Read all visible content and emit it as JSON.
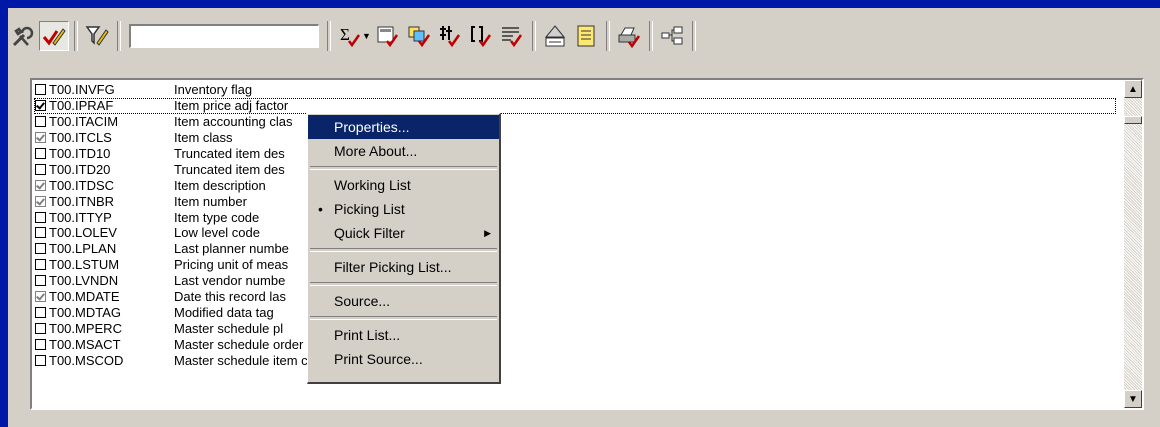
{
  "toolbar": {
    "buttons": [
      "tools-icon",
      "check-pencil-icon",
      "filter-icon"
    ],
    "search_value": ""
  },
  "list": {
    "rows": [
      {
        "name": "T00.INVFG",
        "desc": "Inventory flag",
        "state": "unchecked"
      },
      {
        "name": "T00.IPRAF",
        "desc": "Item price adj factor",
        "state": "checked"
      },
      {
        "name": "T00.ITACIM",
        "desc": "Item accounting clas",
        "state": "unchecked"
      },
      {
        "name": "T00.ITCLS",
        "desc": "Item class",
        "state": "grey"
      },
      {
        "name": "T00.ITD10",
        "desc": "Truncated item des",
        "state": "unchecked"
      },
      {
        "name": "T00.ITD20",
        "desc": "Truncated item des",
        "state": "unchecked"
      },
      {
        "name": "T00.ITDSC",
        "desc": "Item description",
        "state": "grey"
      },
      {
        "name": "T00.ITNBR",
        "desc": "Item number",
        "state": "grey"
      },
      {
        "name": "T00.ITTYP",
        "desc": "Item type code",
        "state": "unchecked"
      },
      {
        "name": "T00.LOLEV",
        "desc": "Low level code",
        "state": "unchecked"
      },
      {
        "name": "T00.LPLAN",
        "desc": "Last planner numbe",
        "state": "unchecked"
      },
      {
        "name": "T00.LSTUM",
        "desc": "Pricing unit of meas",
        "state": "unchecked"
      },
      {
        "name": "T00.LVNDN",
        "desc": "Last vendor numbe",
        "state": "unchecked"
      },
      {
        "name": "T00.MDATE",
        "desc": "Date this record las",
        "state": "grey"
      },
      {
        "name": "T00.MDTAG",
        "desc": "Modified data tag",
        "state": "unchecked"
      },
      {
        "name": "T00.MPERC",
        "desc": "Master schedule pl",
        "state": "unchecked"
      },
      {
        "name": "T00.MSACT",
        "desc": "Master schedule order activity flag",
        "state": "unchecked"
      },
      {
        "name": "T00.MSCOD",
        "desc": "Master schedule item code",
        "state": "unchecked"
      }
    ]
  },
  "context_menu": {
    "items": [
      {
        "label": "Properties...",
        "type": "item",
        "selected": true
      },
      {
        "label": "More About...",
        "type": "item"
      },
      {
        "type": "separator"
      },
      {
        "label": "Working List",
        "type": "item"
      },
      {
        "label": "Picking List",
        "type": "item",
        "bullet": true
      },
      {
        "label": "Quick Filter",
        "type": "item",
        "submenu": true
      },
      {
        "type": "separator"
      },
      {
        "label": "Filter Picking List...",
        "type": "item"
      },
      {
        "type": "separator"
      },
      {
        "label": "Source...",
        "type": "item"
      },
      {
        "type": "separator"
      },
      {
        "label": "Print List...",
        "type": "item"
      },
      {
        "label": "Print Source...",
        "type": "item"
      }
    ]
  },
  "colors": {
    "title_blue": "#0018a8",
    "selection": "#0a246a",
    "check_red": "#c00000"
  }
}
